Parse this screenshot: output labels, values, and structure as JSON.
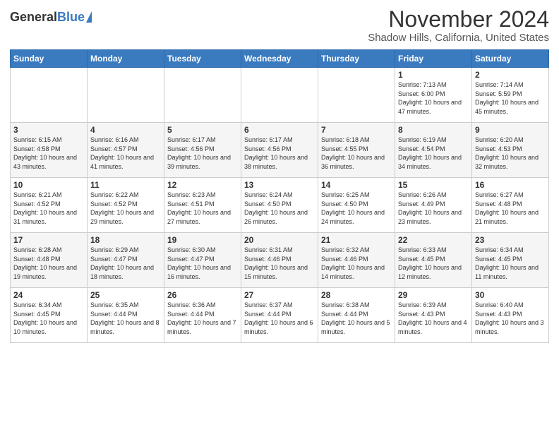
{
  "header": {
    "logo_general": "General",
    "logo_blue": "Blue",
    "month_title": "November 2024",
    "location": "Shadow Hills, California, United States"
  },
  "weekdays": [
    "Sunday",
    "Monday",
    "Tuesday",
    "Wednesday",
    "Thursday",
    "Friday",
    "Saturday"
  ],
  "weeks": [
    [
      {
        "day": "",
        "info": ""
      },
      {
        "day": "",
        "info": ""
      },
      {
        "day": "",
        "info": ""
      },
      {
        "day": "",
        "info": ""
      },
      {
        "day": "",
        "info": ""
      },
      {
        "day": "1",
        "info": "Sunrise: 7:13 AM\nSunset: 6:00 PM\nDaylight: 10 hours and 47 minutes."
      },
      {
        "day": "2",
        "info": "Sunrise: 7:14 AM\nSunset: 5:59 PM\nDaylight: 10 hours and 45 minutes."
      }
    ],
    [
      {
        "day": "3",
        "info": "Sunrise: 6:15 AM\nSunset: 4:58 PM\nDaylight: 10 hours and 43 minutes."
      },
      {
        "day": "4",
        "info": "Sunrise: 6:16 AM\nSunset: 4:57 PM\nDaylight: 10 hours and 41 minutes."
      },
      {
        "day": "5",
        "info": "Sunrise: 6:17 AM\nSunset: 4:56 PM\nDaylight: 10 hours and 39 minutes."
      },
      {
        "day": "6",
        "info": "Sunrise: 6:17 AM\nSunset: 4:56 PM\nDaylight: 10 hours and 38 minutes."
      },
      {
        "day": "7",
        "info": "Sunrise: 6:18 AM\nSunset: 4:55 PM\nDaylight: 10 hours and 36 minutes."
      },
      {
        "day": "8",
        "info": "Sunrise: 6:19 AM\nSunset: 4:54 PM\nDaylight: 10 hours and 34 minutes."
      },
      {
        "day": "9",
        "info": "Sunrise: 6:20 AM\nSunset: 4:53 PM\nDaylight: 10 hours and 32 minutes."
      }
    ],
    [
      {
        "day": "10",
        "info": "Sunrise: 6:21 AM\nSunset: 4:52 PM\nDaylight: 10 hours and 31 minutes."
      },
      {
        "day": "11",
        "info": "Sunrise: 6:22 AM\nSunset: 4:52 PM\nDaylight: 10 hours and 29 minutes."
      },
      {
        "day": "12",
        "info": "Sunrise: 6:23 AM\nSunset: 4:51 PM\nDaylight: 10 hours and 27 minutes."
      },
      {
        "day": "13",
        "info": "Sunrise: 6:24 AM\nSunset: 4:50 PM\nDaylight: 10 hours and 26 minutes."
      },
      {
        "day": "14",
        "info": "Sunrise: 6:25 AM\nSunset: 4:50 PM\nDaylight: 10 hours and 24 minutes."
      },
      {
        "day": "15",
        "info": "Sunrise: 6:26 AM\nSunset: 4:49 PM\nDaylight: 10 hours and 23 minutes."
      },
      {
        "day": "16",
        "info": "Sunrise: 6:27 AM\nSunset: 4:48 PM\nDaylight: 10 hours and 21 minutes."
      }
    ],
    [
      {
        "day": "17",
        "info": "Sunrise: 6:28 AM\nSunset: 4:48 PM\nDaylight: 10 hours and 19 minutes."
      },
      {
        "day": "18",
        "info": "Sunrise: 6:29 AM\nSunset: 4:47 PM\nDaylight: 10 hours and 18 minutes."
      },
      {
        "day": "19",
        "info": "Sunrise: 6:30 AM\nSunset: 4:47 PM\nDaylight: 10 hours and 16 minutes."
      },
      {
        "day": "20",
        "info": "Sunrise: 6:31 AM\nSunset: 4:46 PM\nDaylight: 10 hours and 15 minutes."
      },
      {
        "day": "21",
        "info": "Sunrise: 6:32 AM\nSunset: 4:46 PM\nDaylight: 10 hours and 14 minutes."
      },
      {
        "day": "22",
        "info": "Sunrise: 6:33 AM\nSunset: 4:45 PM\nDaylight: 10 hours and 12 minutes."
      },
      {
        "day": "23",
        "info": "Sunrise: 6:34 AM\nSunset: 4:45 PM\nDaylight: 10 hours and 11 minutes."
      }
    ],
    [
      {
        "day": "24",
        "info": "Sunrise: 6:34 AM\nSunset: 4:45 PM\nDaylight: 10 hours and 10 minutes."
      },
      {
        "day": "25",
        "info": "Sunrise: 6:35 AM\nSunset: 4:44 PM\nDaylight: 10 hours and 8 minutes."
      },
      {
        "day": "26",
        "info": "Sunrise: 6:36 AM\nSunset: 4:44 PM\nDaylight: 10 hours and 7 minutes."
      },
      {
        "day": "27",
        "info": "Sunrise: 6:37 AM\nSunset: 4:44 PM\nDaylight: 10 hours and 6 minutes."
      },
      {
        "day": "28",
        "info": "Sunrise: 6:38 AM\nSunset: 4:44 PM\nDaylight: 10 hours and 5 minutes."
      },
      {
        "day": "29",
        "info": "Sunrise: 6:39 AM\nSunset: 4:43 PM\nDaylight: 10 hours and 4 minutes."
      },
      {
        "day": "30",
        "info": "Sunrise: 6:40 AM\nSunset: 4:43 PM\nDaylight: 10 hours and 3 minutes."
      }
    ]
  ]
}
